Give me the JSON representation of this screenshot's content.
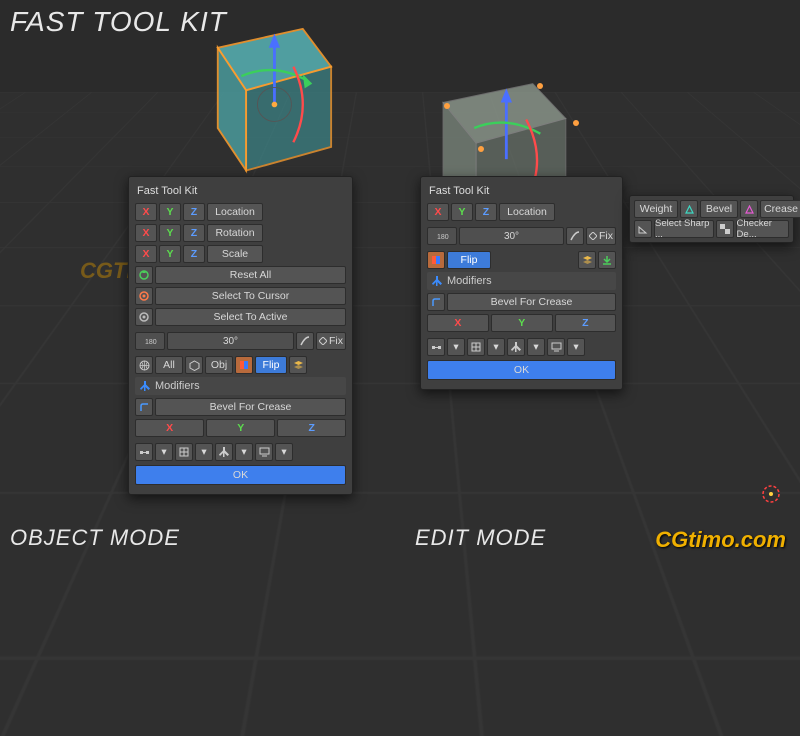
{
  "title": "FAST TOOL KIT",
  "modes": {
    "object": "OBJECT MODE",
    "edit": "EDIT MODE"
  },
  "watermark": "CGtimo.com",
  "watermark_mid": "CGTIMO",
  "panel_title": "Fast Tool Kit",
  "axes": {
    "x": "X",
    "y": "Y",
    "z": "Z"
  },
  "transforms": {
    "location": "Location",
    "rotation": "Rotation",
    "scale": "Scale"
  },
  "actions": {
    "reset_all": "Reset All",
    "select_cursor": "Select To Cursor",
    "select_active": "Select To Active",
    "all": "All",
    "obj": "Obj",
    "flip": "Flip",
    "fix": "Fix",
    "ok": "OK"
  },
  "angle": "30°",
  "angle_field": "180°",
  "modifiers": {
    "header": "Modifiers",
    "bevel_for_crease": "Bevel For Crease"
  },
  "edit": {
    "weight": "Weight",
    "bevel": "Bevel",
    "crease": "Crease",
    "select_sharp": "Select Sharp ...",
    "checker": "Checker De..."
  }
}
